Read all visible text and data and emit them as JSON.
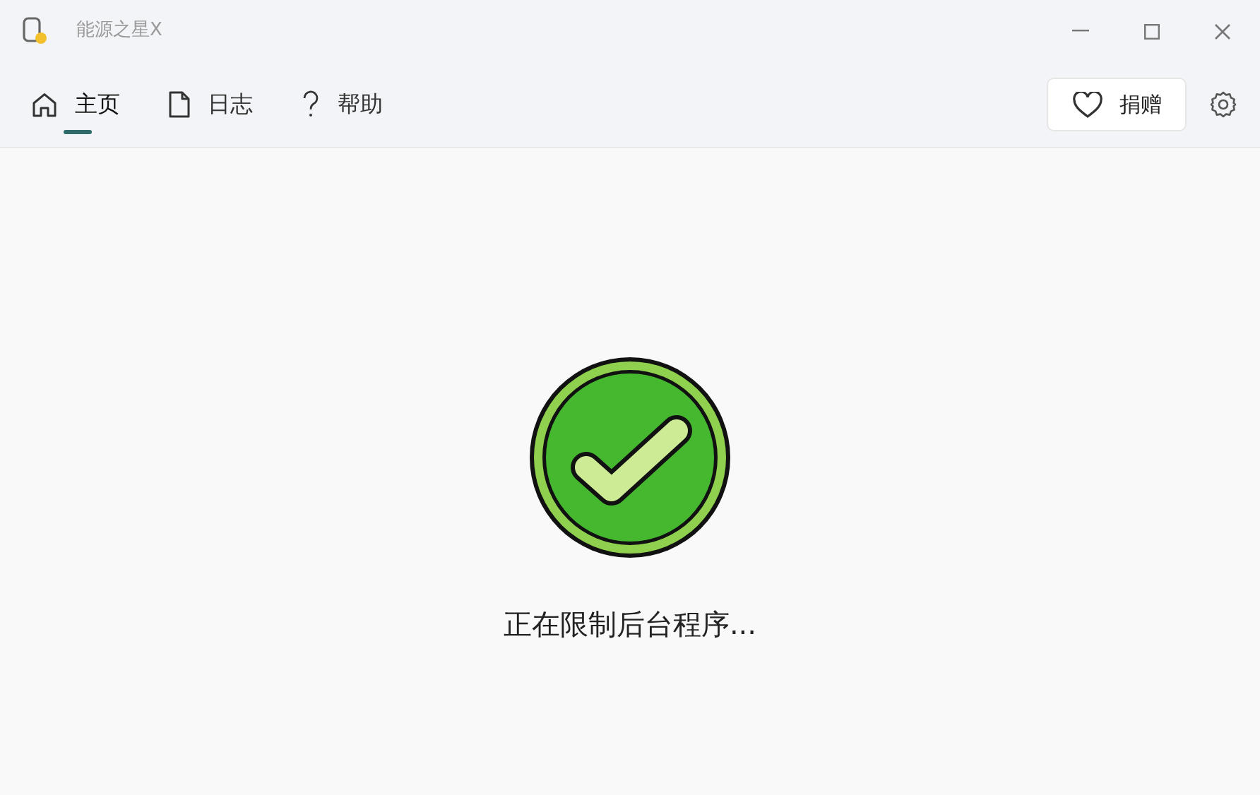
{
  "window": {
    "title": "能源之星X"
  },
  "tabs": [
    {
      "label": "主页",
      "kind": "home",
      "selected": true
    },
    {
      "label": "日志",
      "kind": "document",
      "selected": false
    },
    {
      "label": "帮助",
      "kind": "question",
      "selected": false
    }
  ],
  "donate_button": {
    "label": "捐赠"
  },
  "status": {
    "message": "正在限制后台程序..."
  }
}
